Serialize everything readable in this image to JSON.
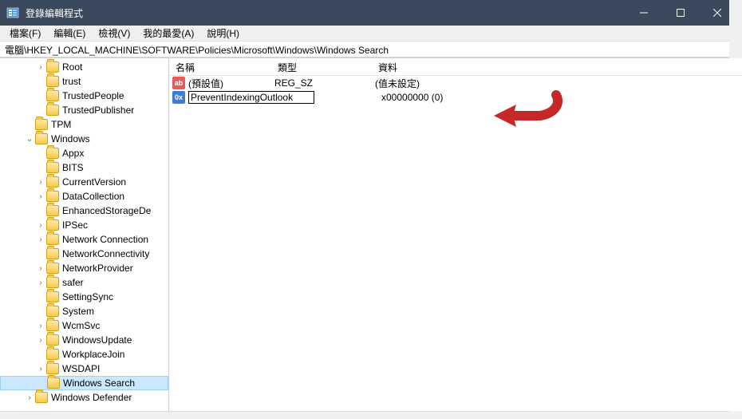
{
  "window": {
    "title": "登錄編輯程式"
  },
  "menu": {
    "file": "檔案(F)",
    "edit": "編輯(E)",
    "view": "檢視(V)",
    "favorites": "我的最愛(A)",
    "help": "說明(H)"
  },
  "address": "電腦\\HKEY_LOCAL_MACHINE\\SOFTWARE\\Policies\\Microsoft\\Windows\\Windows Search",
  "columns": {
    "name": "名稱",
    "type": "類型",
    "data": "資料"
  },
  "values": {
    "default": {
      "name": "(預設值)",
      "type": "REG_SZ",
      "data": "(值未設定)"
    },
    "editing": {
      "value": "PreventIndexingOutlook",
      "data": "x00000000 (0)"
    }
  },
  "tree": {
    "root": "Root",
    "trust": "trust",
    "trustedPeople": "TrustedPeople",
    "trustedPublisher": "TrustedPublisher",
    "tpm": "TPM",
    "windows": "Windows",
    "appx": "Appx",
    "bits": "BITS",
    "currentVersion": "CurrentVersion",
    "dataCollection": "DataCollection",
    "enhancedStorage": "EnhancedStorageDe",
    "ipSec": "IPSec",
    "networkConnections": "Network Connection",
    "networkConnectivity": "NetworkConnectivity",
    "networkProvider": "NetworkProvider",
    "safer": "safer",
    "settingSync": "SettingSync",
    "system": "System",
    "wcmSvc": "WcmSvc",
    "windowsUpdate": "WindowsUpdate",
    "workplaceJoin": "WorkplaceJoin",
    "wsdapi": "WSDAPI",
    "windowsSearch": "Windows Search",
    "windowsDefender": "Windows Defender"
  }
}
